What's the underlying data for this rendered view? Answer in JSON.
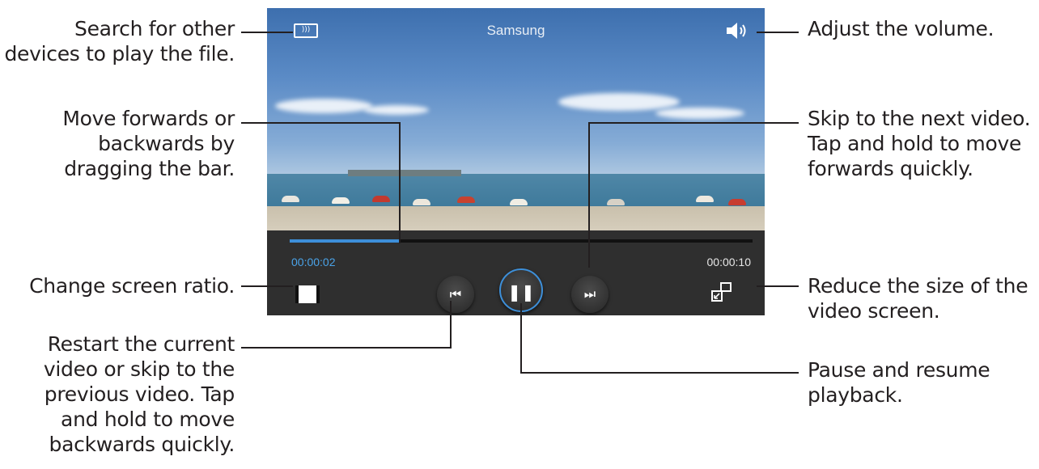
{
  "player": {
    "title": "Samsung",
    "elapsed": "00:00:02",
    "total": "00:00:10",
    "progress": 0.24,
    "accent_color": "#3d8fd9",
    "icons": {
      "devices": "devices-search-icon",
      "volume": "volume-icon",
      "ratio": "screen-ratio-icon",
      "prev": "previous-icon",
      "play_pause": "pause-icon",
      "next": "next-icon",
      "popup": "pop-up-player-icon"
    }
  },
  "callouts": {
    "search_devices": "Search for other\ndevices to play the file.",
    "scrub": "Move forwards or\nbackwards by\ndragging the bar.",
    "ratio": "Change screen ratio.",
    "restart": "Restart the current\nvideo or skip to the\nprevious video. Tap\nand hold to move\nbackwards quickly.",
    "volume": "Adjust the volume.",
    "next": "Skip to the next video.\nTap and hold to move\nforwards quickly.",
    "popup": "Reduce the size of the\nvideo screen.",
    "pause": "Pause and resume\nplayback."
  }
}
